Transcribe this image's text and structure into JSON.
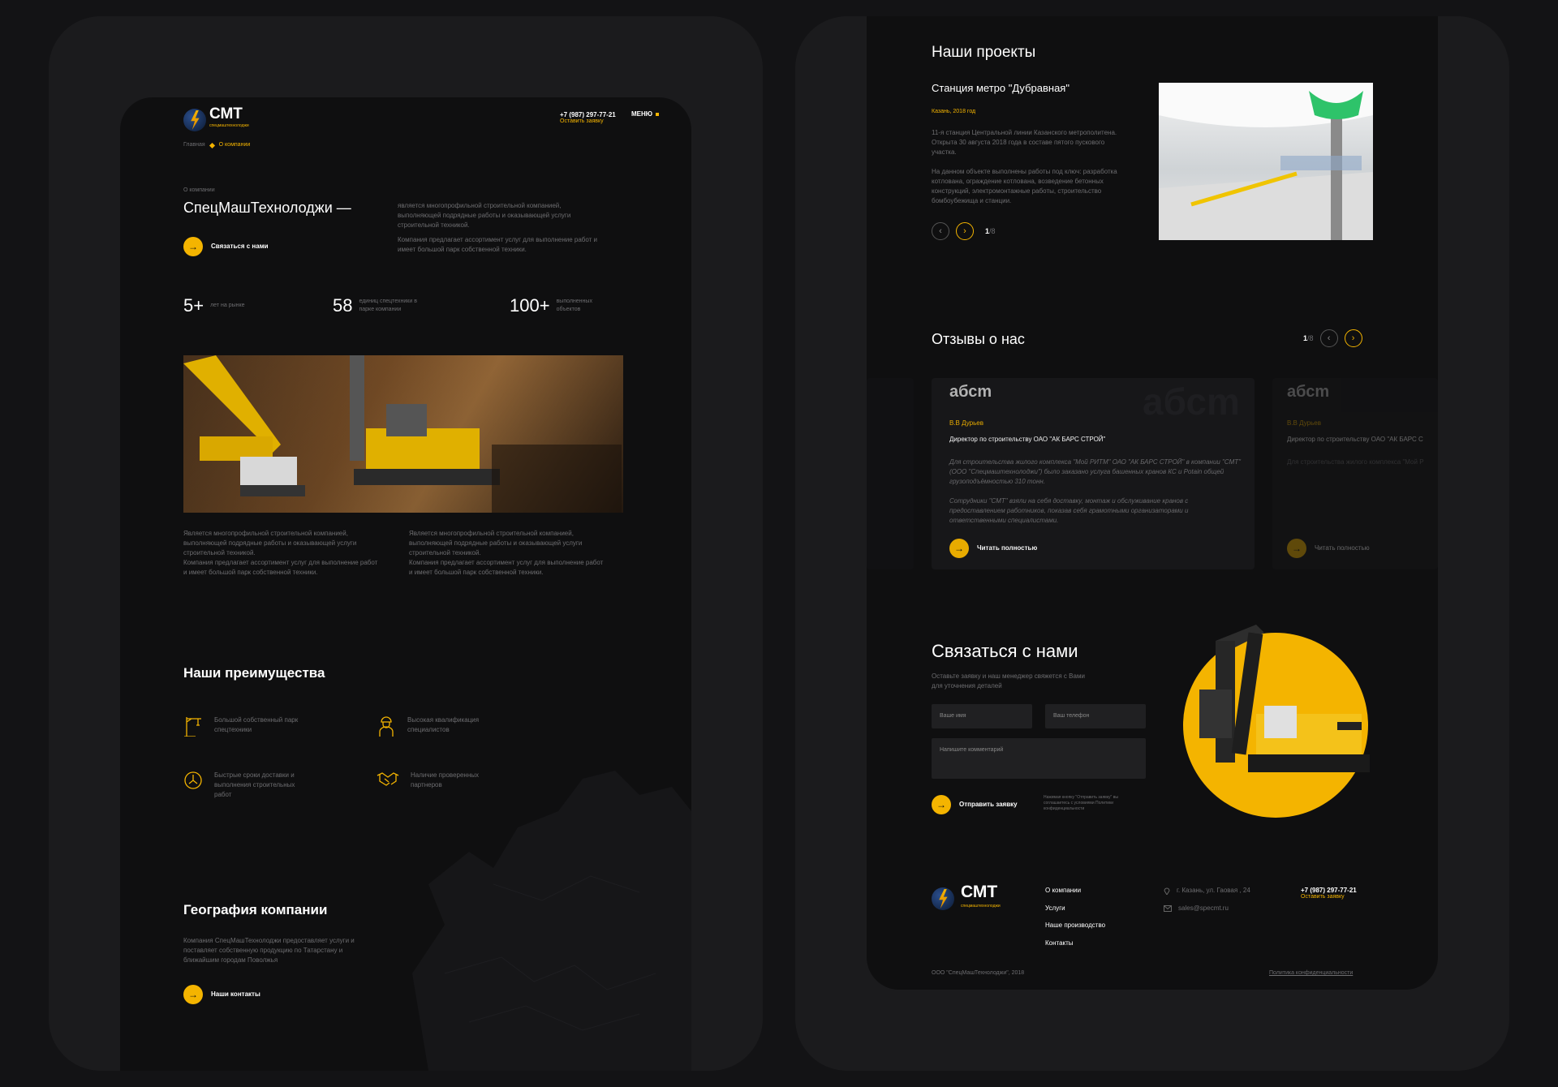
{
  "left": {
    "logo": {
      "name": "СМТ",
      "tagline": "спецмаштехнолоджи"
    },
    "header": {
      "phone": "+7 (987) 297-77-21",
      "request_link": "Оставить заявку",
      "menu_label": "МЕНЮ"
    },
    "breadcrumb": {
      "home": "Главная",
      "current": "О компании"
    },
    "hero": {
      "eyebrow": "О компании",
      "title": "СпецМашТехнолоджи —",
      "desc_1": "является многопрофильной строительной компанией, выполняющей подрядные работы и оказывающей услуги строительной техникой.",
      "desc_2": "Компания предлагает ассортимент услуг для выполнение работ и имеет большой парк собственной техники.",
      "cta_label": "Связаться с нами"
    },
    "stats": [
      {
        "value": "5+",
        "label": "лет на рынке"
      },
      {
        "value": "58",
        "label": "единиц спецтехники в парке компании"
      },
      {
        "value": "100+",
        "label": "выполненных объектов"
      }
    ],
    "about_columns": [
      {
        "p1": "Является многопрофильной строительной компанией, выполняющей подрядные работы и оказывающей услуги строительной техникой.",
        "p2": "Компания предлагает ассортимент услуг для выполнение работ и имеет большой парк собственной техники."
      },
      {
        "p1": "Является многопрофильной строительной компанией, выполняющей подрядные работы и оказывающей услуги строительной техникой.",
        "p2": "Компания предлагает ассортимент услуг для выполнение работ и имеет большой парк собственной техники."
      }
    ],
    "advantages": {
      "title": "Наши преимущества",
      "items": [
        {
          "icon": "crane-icon",
          "text": "Большой собственный парк спецтехники"
        },
        {
          "icon": "worker-icon",
          "text": "Высокая квалификация специалистов"
        },
        {
          "icon": "clock-icon",
          "text": "Быстрые сроки доставки и выполнения строительных работ"
        },
        {
          "icon": "handshake-icon",
          "text": "Наличие проверенных партнеров"
        }
      ]
    },
    "geography": {
      "title": "География компании",
      "text": "Компания СпецМашТехнолоджи предоставляет услуги и поставляет собственную продукцию по Татарстану и ближайшим городам Поволжья",
      "cta_label": "Наши контакты"
    }
  },
  "right": {
    "projects": {
      "title": "Наши проекты",
      "name": "Станция метро \"Дубравная\"",
      "meta": "Казань, 2018 год",
      "p1": "11-я станция Центральной линии Казанского метрополитена. Открыта 30 августа 2018 года в составе пятого пускового участка.",
      "p2": "На данном объекте выполнены работы под ключ: разработка котлована, ограждение котлована, возведение бетонных конструкций, электромонтажные работы, строительство бомбоубежища и станции.",
      "pager_current": "1",
      "pager_total": "/8"
    },
    "reviews": {
      "title": "Отзывы о нас",
      "pager_current": "1",
      "pager_total": "/8",
      "card": {
        "logo": "абсm",
        "name": "В.В Дурьев",
        "position": "Директор по строительству ОАО \"АК БАРС СТРОЙ\"",
        "p1": "Для строительства жилого комплекса \"Мой РИТМ\" ОАО \"АК БАРС СТРОЙ\" в компании \"СМТ\" (ООО \"Спецмаштехнолоджи\") было заказано услуга башенных кранов КС и Potain общей грузоподъёмностью 310 тонн.",
        "p2": "Сотрудники \"СМТ\" взяли на себя доставку, монтаж и обслуживание кранов с предоставлением работников, показав себя грамотными организаторами и ответственными специалистами.",
        "read_more": "Читать полностью"
      },
      "ghost_card": {
        "logo": "абсm",
        "name": "В.В Дурьев",
        "position": "Директор по строительству ОАО \"АК БАРС С",
        "p1": "Для строительства жилого комплекса \"Мой Р",
        "read_more": "Читать полностью"
      }
    },
    "contact": {
      "title": "Связаться с нами",
      "subtitle": "Оставьте заявку и наш менеджер свяжется с Вами для уточнения деталей",
      "name_placeholder": "Ваше имя",
      "phone_placeholder": "Ваш телефон",
      "comment_placeholder": "Напишите комментарий",
      "submit_label": "Отправить заявку",
      "consent": "Нажимая кнопку \"Отправить заявку\" вы соглашаетесь с условиями Политики конфиденциальности"
    },
    "footer": {
      "logo_name": "СМТ",
      "logo_tagline": "спецмаштехнолоджи",
      "nav": [
        "О компании",
        "Услуги",
        "Наше производство",
        "Контакты"
      ],
      "address": "г. Казань, ул. Гаовая , 24",
      "email": "sales@specmt.ru",
      "phone": "+7 (987) 297-77-21",
      "request_link": "Оставить заявку",
      "copyright": "ООО \"СпецМашТехнолоджи\", 2018",
      "privacy": "Политика конфиденциальности"
    }
  },
  "colors": {
    "accent": "#f4b400",
    "background": "#0f0f10",
    "frame": "#1b1b1d"
  }
}
